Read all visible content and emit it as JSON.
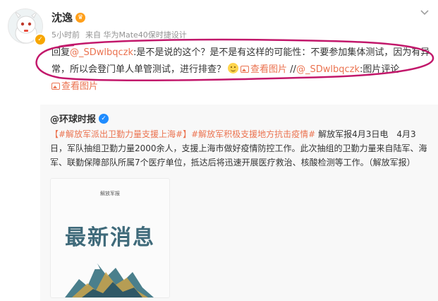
{
  "post": {
    "username": "沈逸",
    "time": "5小时前",
    "source": "来自 华为Mate40保时捷设计",
    "reply_prefix": "回复",
    "mention": "@_SDwlbqczk",
    "text": ":是不是说的这个？是不是有这样的可能性：不要参加集体测试，因为有异常，所以会登门单人单管测试，进行排查？",
    "view_image": "查看图片",
    "separator": " //",
    "mention2": "@_SDwlbqczk",
    "text2": ":图片评论",
    "view_image2": "查看图片"
  },
  "repost": {
    "author": "@环球时报",
    "topic1": "【#解放军派出卫勤力量支援上海#】",
    "topic2": "#解放军积极支援地方抗击疫情#",
    "body": " 解放军报4月3日电　4月3日，军队抽组卫勤力量2000余人，支援上海市做好疫情防控工作。此次抽组的卫勤力量来自陆军、海军、联勤保障部队所属7个医疗单位，抵达后将迅速开展医疗救治、核酸检测等工作。（解放军报）",
    "thumb_brand": "解放军报",
    "thumb_title": "最新消息"
  },
  "icons": {
    "crown": "crown-badge-icon",
    "verified": "verified-badge-icon",
    "chevron": "chevron-down-icon",
    "emoji": "smile-emoji-icon",
    "picture": "picture-icon"
  },
  "colors": {
    "link": "#eb7350",
    "annotation": "#c2186b",
    "repost_bg": "#f8f8f8",
    "blue_v": "#1f8cff"
  }
}
